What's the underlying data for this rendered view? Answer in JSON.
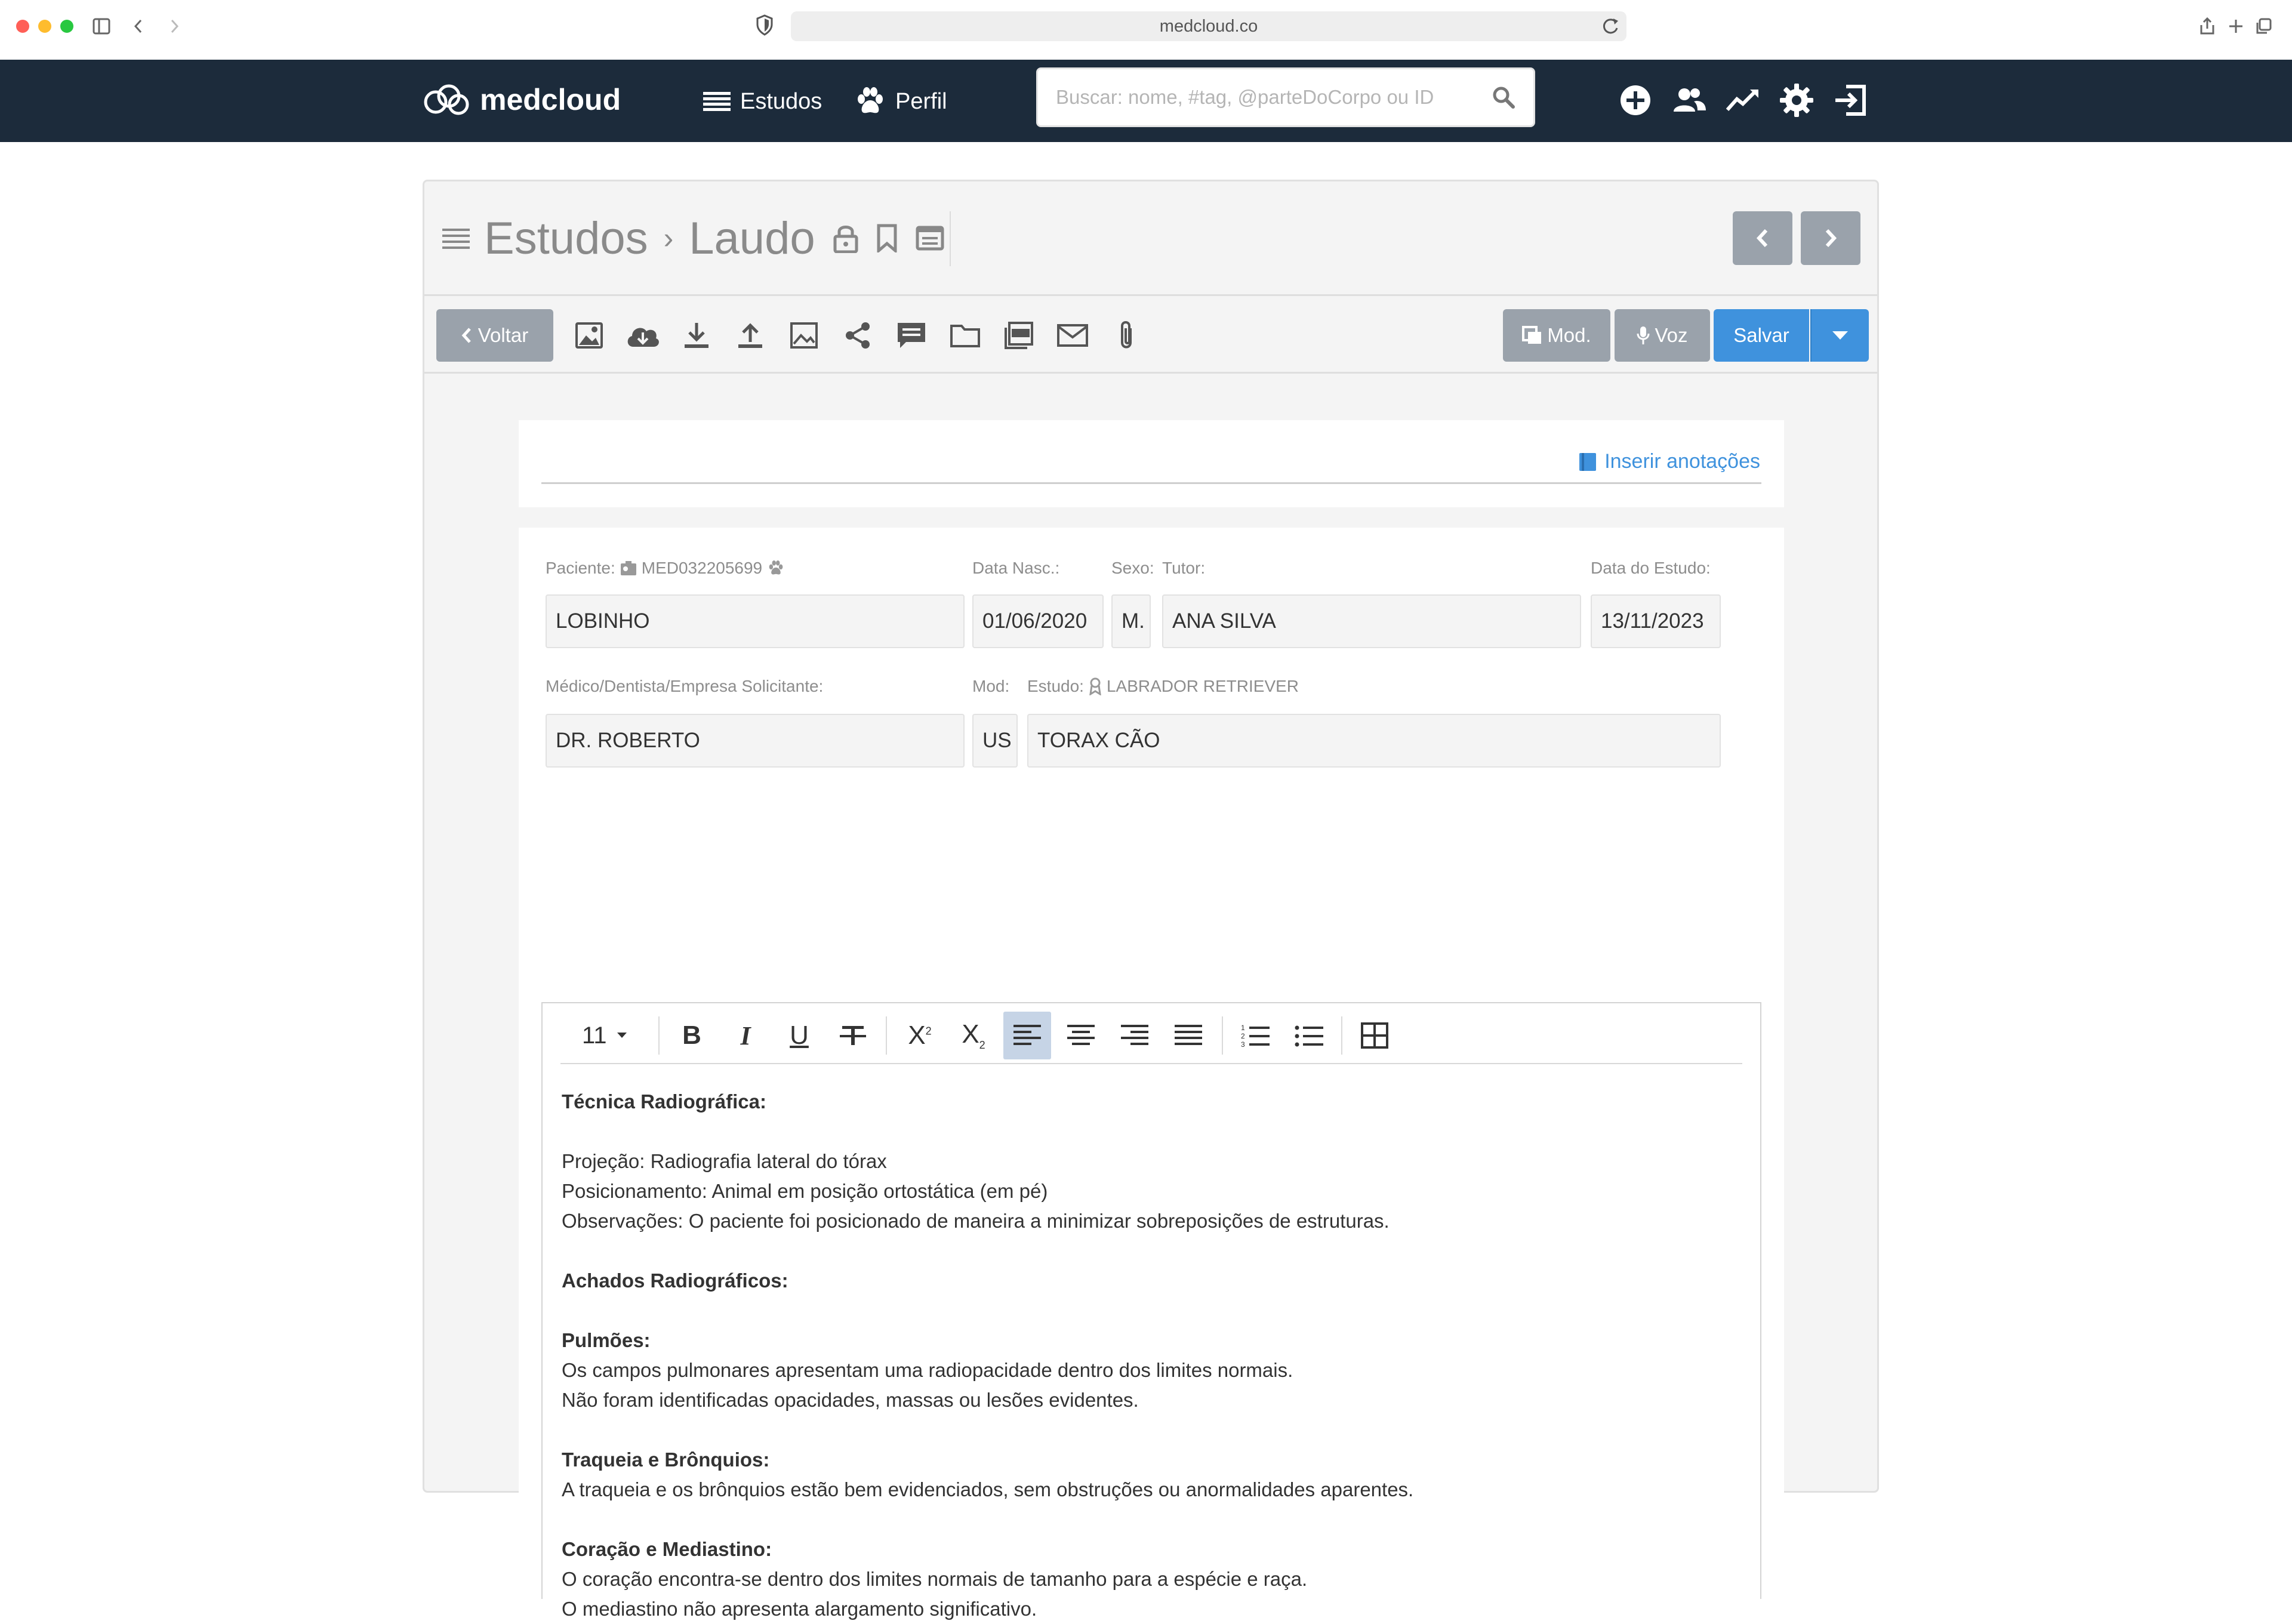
{
  "browser": {
    "url": "medcloud.co"
  },
  "navbar": {
    "logo_text": "medcloud",
    "links": [
      {
        "label": "Estudos",
        "icon": "list-icon"
      },
      {
        "label": "Perfil",
        "icon": "paw-icon"
      }
    ],
    "search_placeholder": "Buscar: nome, #tag, @parteDoCorpo ou ID",
    "search_value": "",
    "actions": [
      "add-icon",
      "users-icon",
      "chart-icon",
      "gear-icon",
      "logout-icon"
    ]
  },
  "breadcrumb": {
    "root": "Estudos",
    "current": "Laudo"
  },
  "toolbar": {
    "back_label": "Voltar",
    "mod_label": "Mod.",
    "voz_label": "Voz",
    "save_label": "Salvar",
    "tools": [
      "image-icon",
      "cloud-download-icon",
      "download-icon",
      "upload-icon",
      "picture-icon",
      "share-icon",
      "comment-icon",
      "folder-icon",
      "pdf-icon",
      "mail-icon",
      "paperclip-icon"
    ]
  },
  "annotations": {
    "link_label": "Inserir anotações"
  },
  "form": {
    "patient_label": "Paciente:",
    "patient_id": "MED032205699",
    "patient_name": "LOBINHO",
    "birth_label": "Data Nasc.:",
    "birth_value": "01/06/2020",
    "sex_label": "Sexo:",
    "sex_value": "M.",
    "tutor_label": "Tutor:",
    "tutor_value": "ANA SILVA",
    "study_date_label": "Data do Estudo:",
    "study_date_value": "13/11/2023",
    "requester_label": "Médico/Dentista/Empresa Solicitante:",
    "requester_value": "DR. ROBERTO",
    "mod_label": "Mod:",
    "mod_value": "US",
    "study_label": "Estudo:",
    "breed": "LABRADOR RETRIEVER",
    "study_value": "TORAX CÃO"
  },
  "editor": {
    "font_size": "11",
    "content": {
      "h1": "Técnica Radiográfica:",
      "l1": "Projeção: Radiografia lateral do tórax",
      "l2": "Posicionamento: Animal em posição ortostática (em pé)",
      "l3": "Observações: O paciente foi posicionado de maneira a minimizar sobreposições de estruturas.",
      "h2": "Achados Radiográficos:",
      "h3": "Pulmões:",
      "l4": "Os campos pulmonares apresentam uma radiopacidade dentro dos limites normais.",
      "l5": "Não foram identificadas opacidades, massas ou lesões evidentes.",
      "h4": "Traqueia e Brônquios:",
      "l6": "A traqueia e os brônquios estão bem evidenciados, sem obstruções ou anormalidades aparentes.",
      "h5": "Coração e Mediastino:",
      "l7": "O coração encontra-se dentro dos limites normais de tamanho para a espécie e raça.",
      "l8": "O mediastino não apresenta alargamento significativo."
    }
  }
}
